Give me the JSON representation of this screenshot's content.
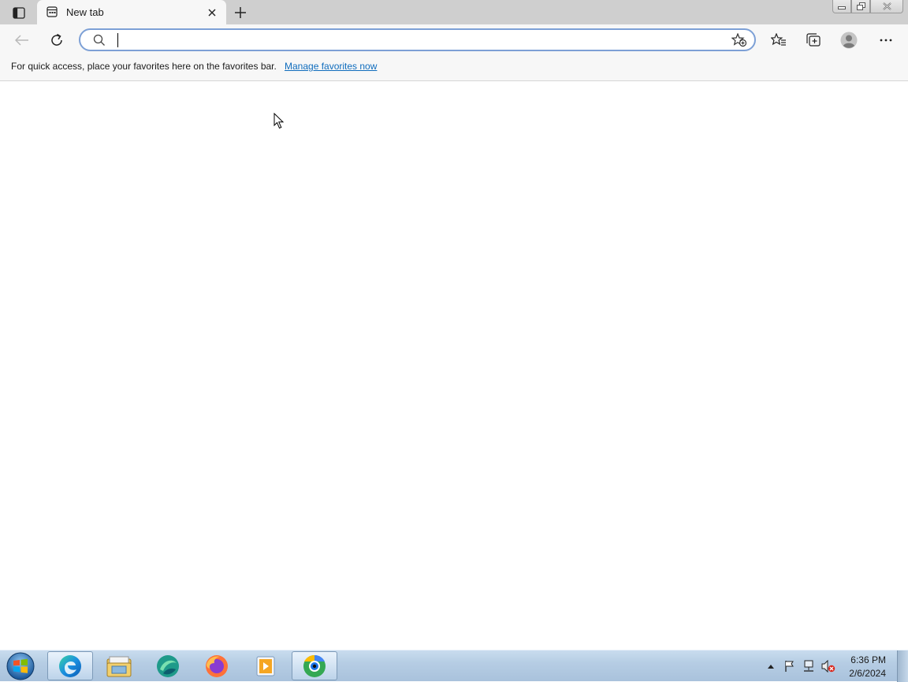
{
  "browser": {
    "tab": {
      "title": "New tab"
    },
    "address_bar": {
      "value": "",
      "placeholder": ""
    },
    "favorites_bar": {
      "message": "For quick access, place your favorites here on the favorites bar.",
      "link": "Manage favorites now"
    },
    "icons": {
      "tab_actions": "tab-actions-icon",
      "tab_favicon": "new-tab-favicon-icon",
      "tab_close": "close-icon",
      "new_tab": "plus-icon",
      "back": "back-arrow-icon",
      "refresh": "refresh-icon",
      "search": "search-icon",
      "add_favorite": "star-add-icon",
      "favorites": "favorites-icon",
      "collections": "collections-icon",
      "profile": "profile-icon",
      "more": "more-icon"
    },
    "accent_color": "#0f6cbd"
  },
  "taskbar": {
    "apps": [
      "edge",
      "file-explorer",
      "app-green",
      "firefox",
      "media-player",
      "app-chrome-like"
    ],
    "clock": {
      "time": "6:36 PM",
      "date": "2/6/2024"
    }
  }
}
